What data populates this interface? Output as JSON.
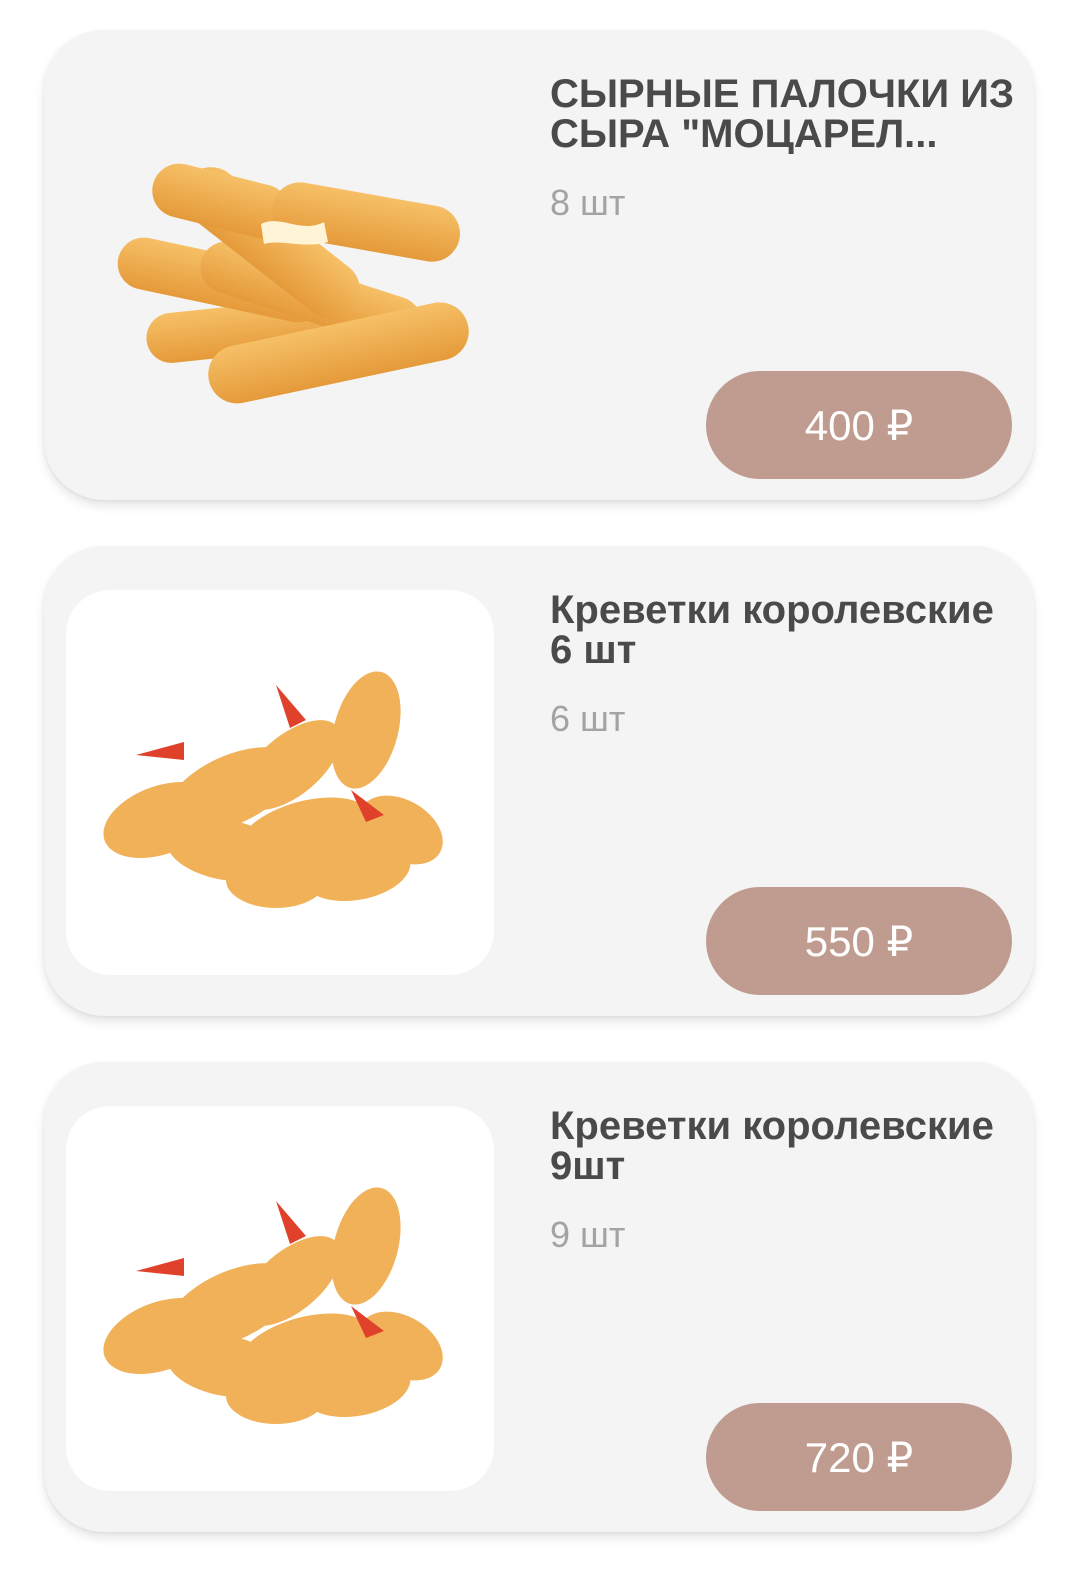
{
  "products": [
    {
      "title": "СЫРНЫЕ ПАЛОЧКИ ИЗ СЫРА \"МОЦАРЕЛ...",
      "quantity": "8 шт",
      "price": "400 ₽",
      "image": "cheese-sticks-photo"
    },
    {
      "title": "Креветки королевские 6 шт",
      "quantity": "6 шт",
      "price": "550 ₽",
      "image": "fried-shrimp-photo"
    },
    {
      "title": "Креветки королевские 9шт",
      "quantity": "9 шт",
      "price": "720 ₽",
      "image": "fried-shrimp-photo"
    }
  ],
  "colors": {
    "card_background": "#f4f4f4",
    "price_button": "#bf9c8f",
    "title_text": "#4a4a4a",
    "quantity_text": "#a3a3a3"
  }
}
